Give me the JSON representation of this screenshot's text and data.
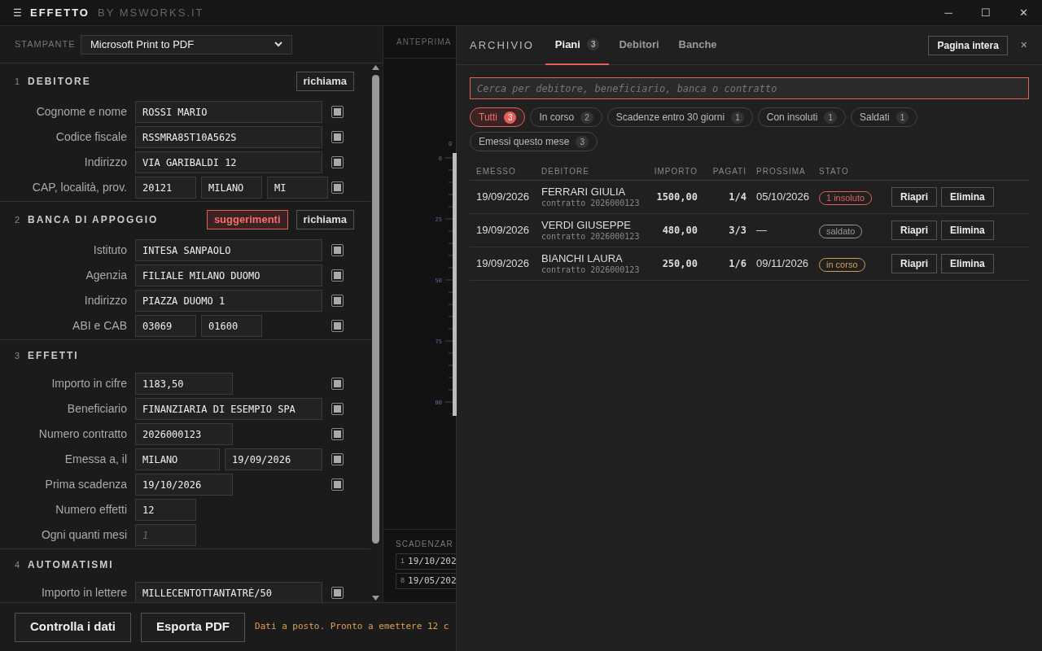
{
  "app": {
    "menu_icon": "☰",
    "title": "EFFETTO",
    "subtitle": "BY MSWORKS.IT"
  },
  "printer": {
    "label": "STAMPANTE",
    "value": "Microsoft Print to PDF"
  },
  "sections": [
    {
      "number": "1",
      "title": "DEBITORE",
      "buttons": [
        {
          "label": "richiama",
          "kind": "plain"
        }
      ],
      "rows": [
        {
          "label": "Cognome e nome",
          "checked": true,
          "fields": [
            {
              "value": "ROSSI MARIO",
              "kind": "long"
            }
          ]
        },
        {
          "label": "Codice fiscale",
          "checked": true,
          "fields": [
            {
              "value": "RSSMRA85T10A562S",
              "kind": "long"
            }
          ]
        },
        {
          "label": "Indirizzo",
          "checked": true,
          "fields": [
            {
              "value": "VIA GARIBALDI 12",
              "kind": "long"
            }
          ]
        },
        {
          "label": "CAP, località, prov.",
          "checked": true,
          "fields": [
            {
              "value": "20121",
              "kind": "short"
            },
            {
              "value": "MILANO",
              "kind": "short"
            },
            {
              "value": "MI",
              "kind": "short"
            }
          ]
        }
      ]
    },
    {
      "number": "2",
      "title": "BANCA DI APPOGGIO",
      "buttons": [
        {
          "label": "suggerimenti",
          "kind": "accent"
        },
        {
          "label": "richiama",
          "kind": "plain"
        }
      ],
      "rows": [
        {
          "label": "Istituto",
          "checked": true,
          "fields": [
            {
              "value": "INTESA SANPAOLO",
              "kind": "long"
            }
          ]
        },
        {
          "label": "Agenzia",
          "checked": true,
          "fields": [
            {
              "value": "FILIALE MILANO DUOMO",
              "kind": "long"
            }
          ]
        },
        {
          "label": "Indirizzo",
          "checked": true,
          "fields": [
            {
              "value": "PIAZZA DUOMO 1",
              "kind": "long"
            }
          ]
        },
        {
          "label": "ABI e CAB",
          "checked": true,
          "fields": [
            {
              "value": "03069",
              "kind": "short"
            },
            {
              "value": "01600",
              "kind": "short"
            }
          ]
        }
      ]
    },
    {
      "number": "3",
      "title": "EFFETTI",
      "rows": [
        {
          "label": "Importo in cifre",
          "checked": true,
          "fields": [
            {
              "value": "1183,50",
              "kind": "medium"
            }
          ]
        },
        {
          "label": "Beneficiario",
          "checked": true,
          "fields": [
            {
              "value": "FINANZIARIA DI ESEMPIO SPA",
              "kind": "long"
            }
          ]
        },
        {
          "label": "Numero contratto",
          "checked": true,
          "fields": [
            {
              "value": "2026000123",
              "kind": "medium"
            }
          ]
        },
        {
          "label": "Emessa a, il",
          "checked": true,
          "fields": [
            {
              "value": "MILANO",
              "kind": "wide"
            },
            {
              "value": "19/09/2026",
              "kind": "medium"
            }
          ]
        },
        {
          "label": "Prima scadenza",
          "checked": true,
          "fields": [
            {
              "value": "19/10/2026",
              "kind": "medium"
            }
          ]
        },
        {
          "label": "Numero effetti",
          "fields": [
            {
              "value": "12",
              "kind": "short"
            }
          ]
        },
        {
          "label": "Ogni quanti mesi",
          "fields": [
            {
              "placeholder": "1",
              "kind": "short"
            }
          ]
        }
      ]
    },
    {
      "number": "4",
      "title": "AUTOMATISMI",
      "rows": [
        {
          "label": "Importo in lettere",
          "checked": true,
          "fields": [
            {
              "value": "MILLECENTOTTANTATRÉ/50",
              "kind": "long"
            }
          ]
        }
      ]
    }
  ],
  "preview": {
    "title": "ANTEPRIMA",
    "top_mark": "0",
    "ruler_labels": [
      "0",
      "25",
      "50",
      "75",
      "00"
    ],
    "schedule_title": "SCADENZAR",
    "schedule": [
      {
        "index": "1",
        "date": "19/10/202"
      },
      {
        "index": "8",
        "date": "19/05/202"
      }
    ]
  },
  "footer": {
    "buttons": [
      "Controlla i dati",
      "Esporta PDF"
    ],
    "status": "Dati a posto. Pronto a emettere 12 c"
  },
  "window_controls": [
    "─",
    "☐",
    "✕"
  ],
  "archive": {
    "title": "ARCHIVIO",
    "tabs": [
      {
        "label": "Piani",
        "count": "3",
        "selected": true
      },
      {
        "label": "Debitori",
        "selected": false
      },
      {
        "label": "Banche",
        "selected": false
      }
    ],
    "full_page_button": "Pagina intera",
    "close": "×",
    "search": {
      "placeholder": "Cerca per debitore, beneficiario, banca o contratto"
    },
    "filters": [
      {
        "label": "Tutti",
        "count": "3",
        "selected": true
      },
      {
        "label": "In corso",
        "count": "2",
        "selected": false
      },
      {
        "label": "Scadenze entro 30 giorni",
        "count": "1",
        "selected": false
      },
      {
        "label": "Con insoluti",
        "count": "1",
        "selected": false
      },
      {
        "label": "Saldati",
        "count": "1",
        "selected": false
      },
      {
        "label": "Emessi questo mese",
        "count": "3",
        "selected": false
      }
    ],
    "table": {
      "columns": [
        "EMESSO",
        "DEBITORE",
        "IMPORTO",
        "PAGATI",
        "PROSSIMA",
        "STATO"
      ],
      "rows": [
        {
          "issued": "19/09/2026",
          "debtor": "FERRARI GIULIA",
          "contract": "contratto 2026000123",
          "amount": "1500,00",
          "paid": "1/4",
          "next": "05/10/2026",
          "status": "1 insoluto",
          "color": "#e0605a",
          "actions": [
            "Riapri",
            "Elimina"
          ]
        },
        {
          "issued": "19/09/2026",
          "debtor": "VERDI GIUSEPPE",
          "contract": "contratto 2026000123",
          "amount": "480,00",
          "paid": "3/3",
          "next": "—",
          "status": "saldato",
          "color": "#9a9a9a",
          "actions": [
            "Riapri",
            "Elimina"
          ]
        },
        {
          "issued": "19/09/2026",
          "debtor": "BIANCHI LAURA",
          "contract": "contratto 2026000123",
          "amount": "250,00",
          "paid": "1/6",
          "next": "09/11/2026",
          "status": "in corso",
          "color": "#d4a050",
          "actions": [
            "Riapri",
            "Elimina"
          ]
        }
      ]
    }
  }
}
